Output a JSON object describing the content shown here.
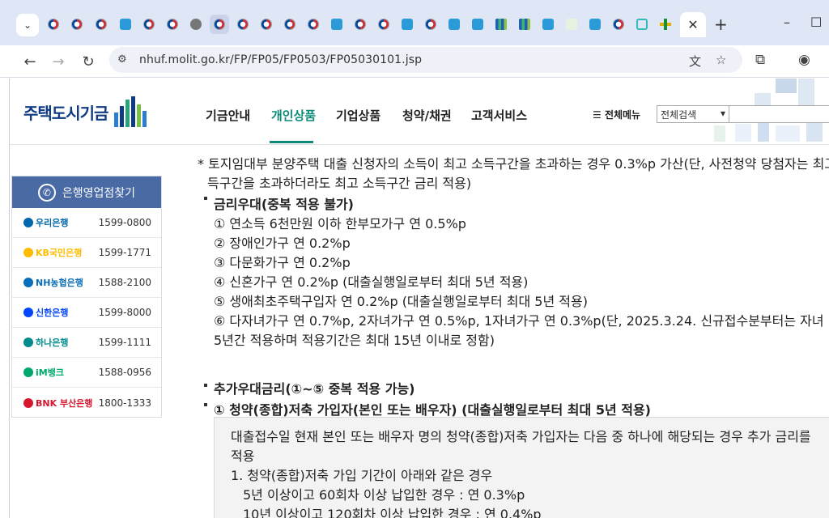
{
  "browser": {
    "tab_search_icon": "chevron-down-icon",
    "active_tab_close": "✕",
    "new_tab": "+",
    "window_controls": {
      "minimize": "–",
      "maximize": "☐",
      "close": "✕"
    },
    "url": "nhuf.molit.go.kr/FP/FP05/FP0503/FP05030101.jsp"
  },
  "site": {
    "logo_text": "주택도시기금",
    "gnb": [
      "기금안내",
      "개인상품",
      "기업상품",
      "청약/채권",
      "고객서비스"
    ],
    "all_menu": "전체메뉴",
    "search_select": "전체검색"
  },
  "sidebar": {
    "title": "은행영업점찾기",
    "banks": [
      {
        "name": "우리은행",
        "tel": "1599-0800",
        "color": "#0067ac"
      },
      {
        "name": "KB국민은행",
        "tel": "1599-1771",
        "color": "#ffbc00"
      },
      {
        "name": "NH농협은행",
        "tel": "1588-2100",
        "color": "#0a6fb8"
      },
      {
        "name": "신한은행",
        "tel": "1599-8000",
        "color": "#0046ff"
      },
      {
        "name": "하나은행",
        "tel": "1599-1111",
        "color": "#008c8c"
      },
      {
        "name": "iM뱅크",
        "tel": "1588-0956",
        "color": "#00a86b"
      },
      {
        "name": "BNK 부산은행",
        "tel": "1800-1333",
        "color": "#d7172f"
      }
    ]
  },
  "content": {
    "note_line1": "* 토지임대부 분양주택 대출 신청자의 소득이 최고 소득구간을 초과하는 경우 0.3%p 가산(단, 사전청약 당첨자는 최고 소",
    "note_line2": "득구간을 초과하더라도 최고 소득구간 금리 적용)",
    "section1_title": "금리우대(중복 적용 불가)",
    "section1_items": [
      "① 연소득 6천만원 이하 한부모가구 연 0.5%p",
      "② 장애인가구 연 0.2%p",
      "③ 다문화가구 연 0.2%p",
      "④ 신혼가구 연 0.2%p (대출실행일로부터 최대 5년 적용)",
      "⑤ 생애최초주택구입자 연 0.2%p (대출실행일로부터 최대 5년 적용)",
      "⑥ 다자녀가구 연 0.7%p, 2자녀가구 연 0.5%p, 1자녀가구 연 0.3%p(단, 2025.3.24. 신규접수분부터는 자녀 1명당",
      "5년간 적용하며 적용기간은 최대 15년 이내로 정함)"
    ],
    "section2_title": "추가우대금리(①~⑤ 중복 적용 가능)",
    "section2_sub": "① 청약(종합)저축 가입자(본인 또는 배우자) (대출실행일로부터 최대 5년 적용)",
    "box_lines": [
      "대출접수일 현재 본인 또는 배우자 명의 청약(종합)저축 가입자는 다음 중 하나에 해당되는 경우 추가 금리를",
      "적용",
      "1. 청약(종합)저축 가입 기간이 아래와 같은 경우",
      "5년 이상이고 60회차 이상 납입한 경우 : 연 0.3%p",
      "10년 이상이고 120회차 이상 납입한 경우 : 연 0.4%p"
    ]
  }
}
